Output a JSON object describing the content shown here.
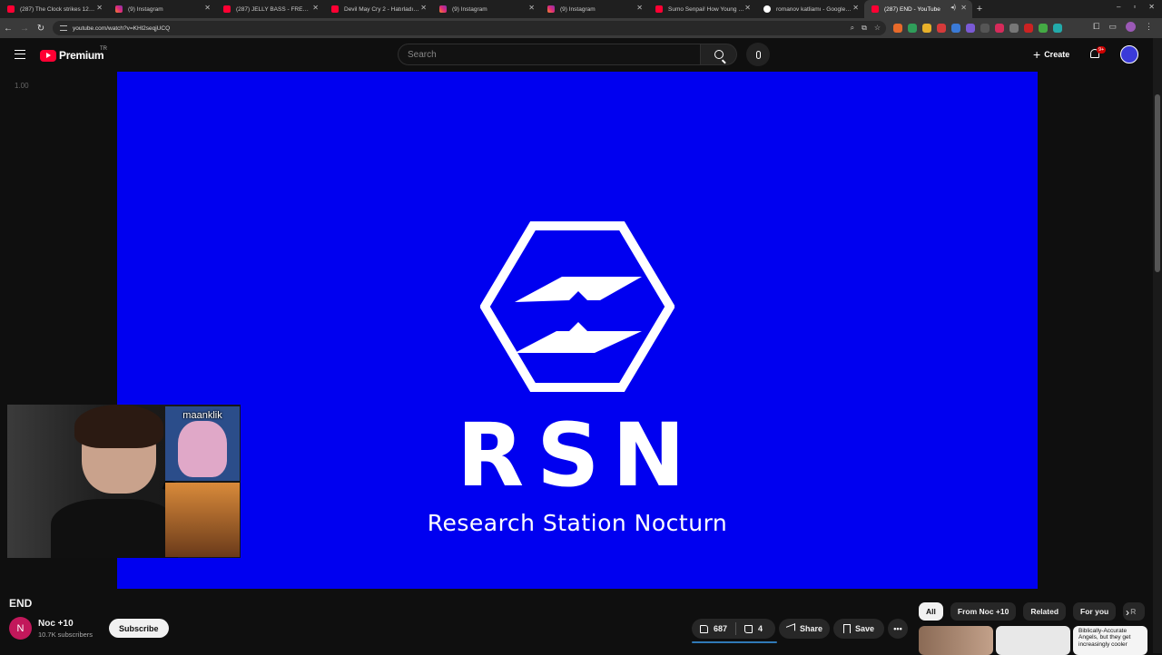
{
  "browser": {
    "tabs": [
      {
        "label": "(287) The Clock strikes 12 - Yo",
        "type": "yt"
      },
      {
        "label": "(9) Instagram",
        "type": "ig"
      },
      {
        "label": "(287) JELLY BASS - FREE STUFF",
        "type": "yt"
      },
      {
        "label": "Devil May Cry 2 - Hatırladığım",
        "type": "yt"
      },
      {
        "label": "(9) Instagram",
        "type": "ig"
      },
      {
        "label": "(9) Instagram",
        "type": "ig"
      },
      {
        "label": "Sumo Senpai! How Young Sumo",
        "type": "yt"
      },
      {
        "label": "romanov katliamı - Google Sea",
        "type": "g"
      },
      {
        "label": "(287) END - YouTube",
        "type": "yt",
        "active": true
      }
    ],
    "url": "youtube.com/watch?v=KHl2seqjUCQ"
  },
  "masthead": {
    "brand": "Premium",
    "country": "TR",
    "search_placeholder": "Search",
    "create_label": "Create",
    "notif_count": "9+"
  },
  "player": {
    "speed": "1.00",
    "logo_text": "RSN",
    "logo_subtitle": "Research Station Nocturn",
    "webcam_overlay_label": "maanklik"
  },
  "video": {
    "title": "END",
    "channel_initial": "N",
    "channel_name": "Noc +10",
    "subscribers": "10.7K subscribers",
    "subscribe_label": "Subscribe",
    "likes": "687",
    "dislikes": "4",
    "share_label": "Share",
    "save_label": "Save"
  },
  "chips": [
    "All",
    "From Noc +10",
    "Related",
    "For you",
    "R"
  ],
  "related": {
    "thumb3_text": "Biblically-Accurate Angels, but they get increasingly cooler"
  },
  "colors": {
    "player_bg": "#0000f0",
    "yt_red": "#ff0033",
    "page_bg": "#0f0f0f"
  }
}
